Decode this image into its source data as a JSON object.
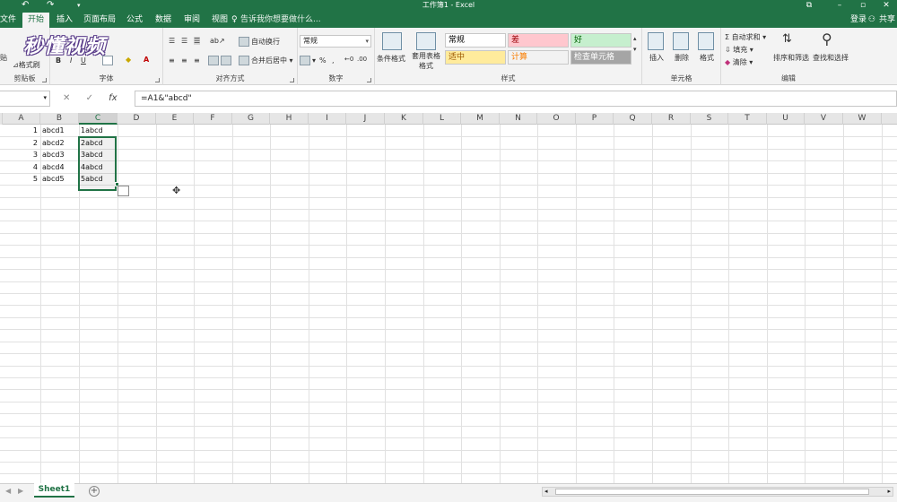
{
  "window": {
    "title": "工作簿1 - Excel"
  },
  "tabs": [
    {
      "label": "文件"
    },
    {
      "label": "开始"
    },
    {
      "label": "插入"
    },
    {
      "label": "页面布局"
    },
    {
      "label": "公式"
    },
    {
      "label": "数据"
    },
    {
      "label": "审阅"
    },
    {
      "label": "视图"
    }
  ],
  "tell_me": "告诉我你想要做什么...",
  "account": {
    "signin": "登录",
    "share": "共享"
  },
  "ribbon": {
    "clipboard": {
      "label": "剪贴板",
      "paste": "贴",
      "format_painter": "格式刷"
    },
    "font": {
      "label": "字体",
      "bold": "B",
      "italic": "I",
      "underline": "U"
    },
    "alignment": {
      "label": "对齐方式",
      "wrap": "自动换行",
      "merge": "合并后居中"
    },
    "number": {
      "label": "数字",
      "format": "常规",
      "percent": "%",
      "comma": ","
    },
    "styles": {
      "label": "样式",
      "conditional": "条件格式",
      "table_format": "套用表格格式",
      "cells": [
        {
          "name": "常规",
          "color": "#000000",
          "bg": "#ffffff"
        },
        {
          "name": "差",
          "color": "#9c0006",
          "bg": "#ffc7ce"
        },
        {
          "name": "好",
          "color": "#006100",
          "bg": "#c6efce"
        },
        {
          "name": "适中",
          "color": "#9c5700",
          "bg": "#ffeb9c"
        },
        {
          "name": "计算",
          "color": "#fa7d00",
          "bg": "#f2f2f2"
        },
        {
          "name": "检查单元格",
          "color": "#ffffff",
          "bg": "#a5a5a5"
        }
      ]
    },
    "cells": {
      "label": "单元格",
      "insert": "插入",
      "delete": "删除",
      "format": "格式"
    },
    "editing": {
      "label": "编辑",
      "autosum": "自动求和",
      "fill": "填充",
      "clear": "清除",
      "sort_filter": "排序和筛选",
      "find_select": "查找和选择"
    }
  },
  "formula_bar": {
    "fx": "fx",
    "formula": "=A1&\"abcd\""
  },
  "columns": [
    "A",
    "B",
    "C",
    "D",
    "E",
    "F",
    "G",
    "H",
    "I",
    "J",
    "K",
    "L",
    "M",
    "N",
    "O",
    "P",
    "Q",
    "R",
    "S",
    "T",
    "U",
    "V",
    "W"
  ],
  "selected_column": "C",
  "rows": [
    {
      "a": "1",
      "b": "abcd1",
      "c": "1abcd"
    },
    {
      "a": "2",
      "b": "abcd2",
      "c": "2abcd"
    },
    {
      "a": "3",
      "b": "abcd3",
      "c": "3abcd"
    },
    {
      "a": "4",
      "b": "abcd4",
      "c": "4abcd"
    },
    {
      "a": "5",
      "b": "abcd5",
      "c": "5abcd"
    }
  ],
  "sheets": [
    {
      "name": "Sheet1"
    }
  ],
  "add_sheet": "+",
  "watermark": "秒懂视频",
  "colors": {
    "accent": "#217346"
  }
}
